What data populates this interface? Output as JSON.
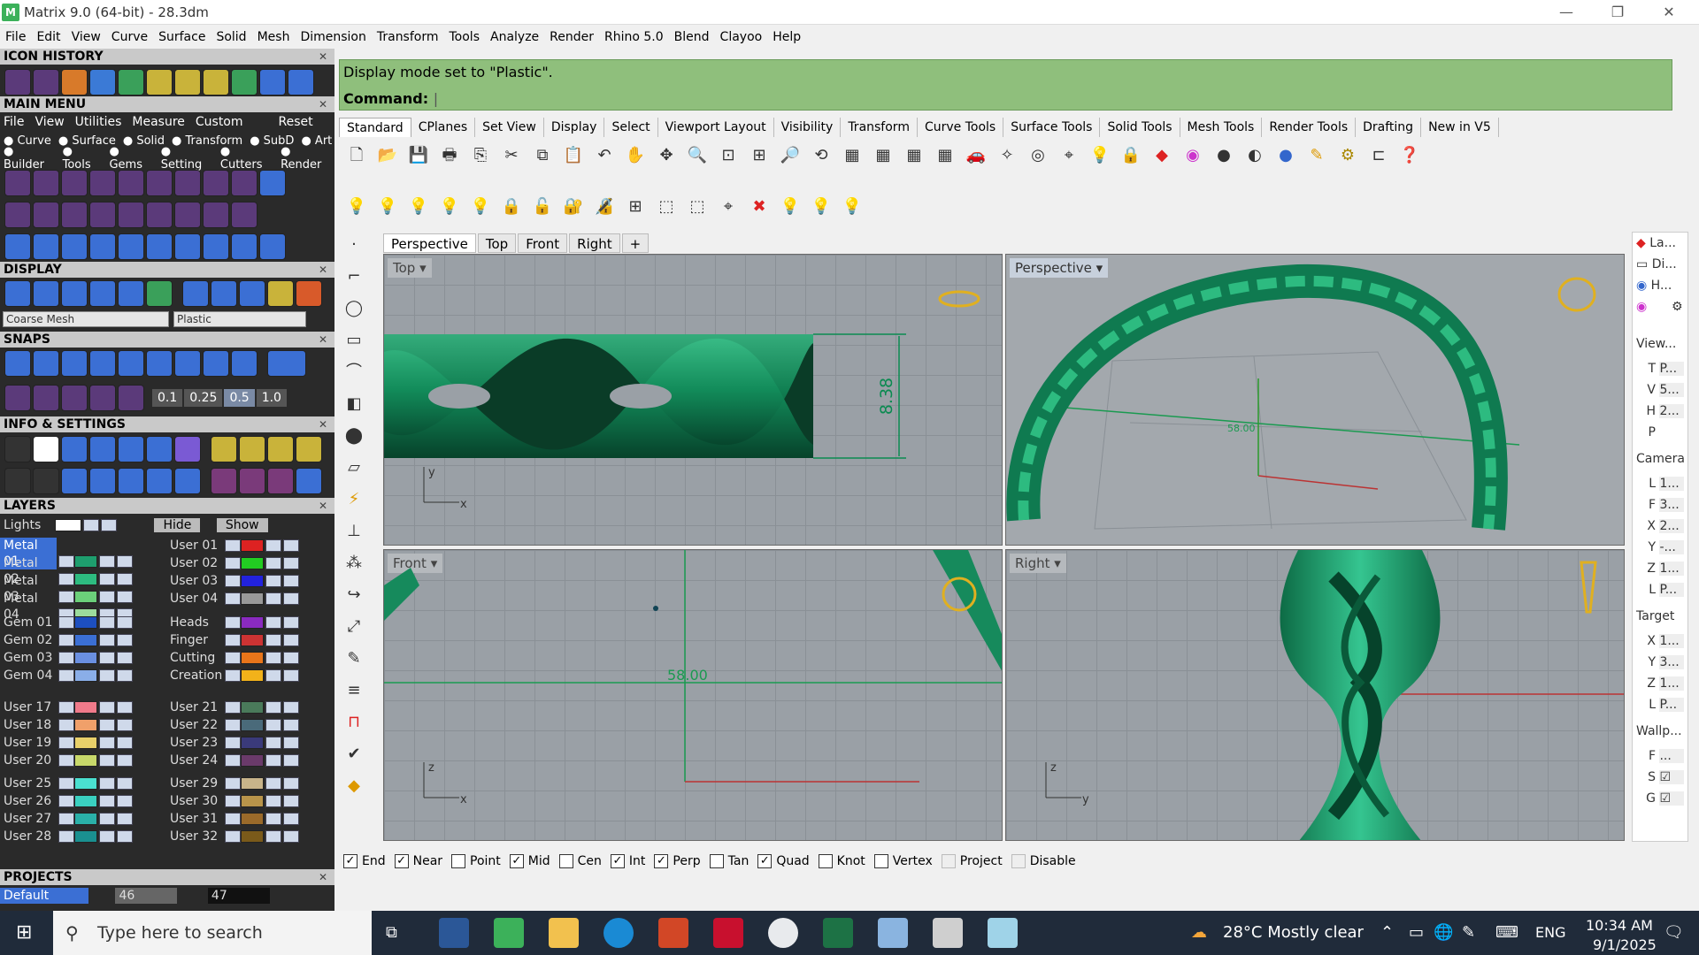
{
  "window": {
    "title": "Matrix 9.0 (64-bit) - 28.3dm",
    "logo": "M"
  },
  "menu": [
    "File",
    "Edit",
    "View",
    "Curve",
    "Surface",
    "Solid",
    "Mesh",
    "Dimension",
    "Transform",
    "Tools",
    "Analyze",
    "Render",
    "Rhino 5.0",
    "Blend",
    "Clayoo",
    "Help"
  ],
  "left": {
    "icon_history": "ICON HISTORY",
    "main_menu": "MAIN MENU",
    "main_menu_items": [
      "File",
      "View",
      "Utilities",
      "Measure",
      "Custom"
    ],
    "reset": "Reset",
    "categories_row1": [
      "Curve",
      "Surface",
      "Solid",
      "Transform",
      "SubD",
      "Art"
    ],
    "categories_row2": [
      "Builder",
      "Tools",
      "Gems",
      "Setting",
      "Cutters",
      "Render"
    ],
    "display": "DISPLAY",
    "display_mesh": "Coarse Mesh",
    "display_mode": "Plastic",
    "snaps": "SNAPS",
    "snap_values": [
      "0.1",
      "0.25",
      "0.5",
      "1.0"
    ],
    "info_settings": "INFO & SETTINGS",
    "layers": "LAYERS",
    "lights": "Lights",
    "hide": "Hide",
    "show": "Show",
    "layers_left_1": [
      "Metal 01",
      "Metal 02",
      "Metal 03",
      "Metal 04"
    ],
    "layers_right_1": [
      "User 01",
      "User 02",
      "User 03",
      "User 04"
    ],
    "layers_left_2": [
      "Gem 01",
      "Gem 02",
      "Gem 03",
      "Gem 04"
    ],
    "layers_right_2": [
      "Heads",
      "Finger",
      "Cutting",
      "Creation"
    ],
    "layers_left_3": [
      "User 17",
      "User 18",
      "User 19",
      "User 20"
    ],
    "layers_right_3": [
      "User 21",
      "User 22",
      "User 23",
      "User 24"
    ],
    "layers_left_4": [
      "User 25",
      "User 26",
      "User 27",
      "User 28"
    ],
    "layers_right_4": [
      "User 29",
      "User 30",
      "User 31",
      "User 32"
    ],
    "projects": "PROJECTS",
    "project_name": "Default",
    "page_a": "46",
    "page_b": "47"
  },
  "command": {
    "message": "Display mode set to \"Plastic\".",
    "prompt": "Command:"
  },
  "tabs": [
    "Standard",
    "CPlanes",
    "Set View",
    "Display",
    "Select",
    "Viewport Layout",
    "Visibility",
    "Transform",
    "Curve Tools",
    "Surface Tools",
    "Solid Tools",
    "Mesh Tools",
    "Render Tools",
    "Drafting",
    "New in V5"
  ],
  "viewport_tabs": [
    "Perspective",
    "Top",
    "Front",
    "Right"
  ],
  "viewports": {
    "top": {
      "label": "Top",
      "dim": "8.38"
    },
    "perspective": {
      "label": "Perspective",
      "dim": "58.00"
    },
    "front": {
      "label": "Front",
      "dim": "58.00"
    },
    "right": {
      "label": "Right"
    }
  },
  "axis": {
    "x": "x",
    "y": "y",
    "z": "z"
  },
  "right_panel": {
    "tabs": [
      "La...",
      "Di...",
      "H..."
    ],
    "view": "View...",
    "view_rows": [
      "T",
      "V",
      "H",
      "P"
    ],
    "view_vals": [
      "P...",
      "5...",
      "2...",
      ""
    ],
    "camera": "Camera",
    "camera_rows": [
      "L",
      "F",
      "X",
      "Y",
      "Z",
      "L"
    ],
    "camera_vals": [
      "1...",
      "3...",
      "2...",
      "-...",
      "1...",
      "P..."
    ],
    "target": "Target",
    "target_rows": [
      "X",
      "Y",
      "Z",
      "L"
    ],
    "target_vals": [
      "1...",
      "3...",
      "1...",
      "P..."
    ],
    "wallp": "Wallp...",
    "wallp_rows": [
      "F",
      "S",
      "G"
    ],
    "wallp_vals": [
      "...",
      "☑",
      "☑"
    ]
  },
  "osnaps": [
    {
      "label": "End",
      "checked": true
    },
    {
      "label": "Near",
      "checked": true
    },
    {
      "label": "Point",
      "checked": false
    },
    {
      "label": "Mid",
      "checked": true
    },
    {
      "label": "Cen",
      "checked": false
    },
    {
      "label": "Int",
      "checked": true
    },
    {
      "label": "Perp",
      "checked": true
    },
    {
      "label": "Tan",
      "checked": false
    },
    {
      "label": "Quad",
      "checked": true
    },
    {
      "label": "Knot",
      "checked": false
    },
    {
      "label": "Vertex",
      "checked": false
    },
    {
      "label": "Project",
      "checked": false,
      "disabled": true
    },
    {
      "label": "Disable",
      "checked": false,
      "disabled": true
    }
  ],
  "taskbar": {
    "search_placeholder": "Type here to search",
    "weather": "28°C  Mostly clear",
    "lang": "ENG",
    "time": "10:34 AM",
    "date": "9/1/2025"
  },
  "colors": {
    "model": "#1e9e6e",
    "model_dark": "#0d5a3c",
    "cmd_bg": "#8fbf7c"
  }
}
